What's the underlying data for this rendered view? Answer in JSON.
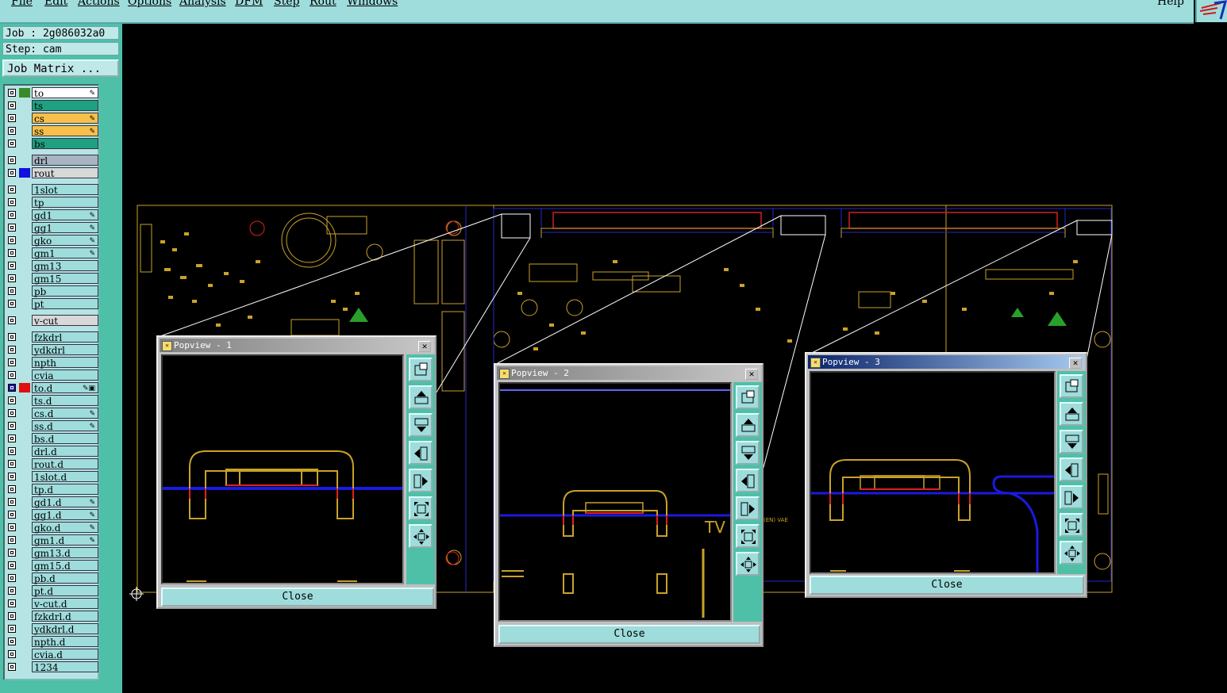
{
  "menu": [
    "File",
    "Edit",
    "Actions",
    "Options",
    "Analysis",
    "DFM",
    "Step",
    "Rout",
    "Windows"
  ],
  "help": "Help",
  "job_label": "Job : 2g086032a0",
  "step_label": "Step: cam",
  "job_matrix_label": "Job Matrix ...",
  "layers": [
    {
      "name": "to",
      "bg": "#ffffff",
      "swatch": "#3a8a2a",
      "flag": "✎"
    },
    {
      "name": "ts",
      "bg": "#1fa080",
      "swatch": "",
      "flag": ""
    },
    {
      "name": "cs",
      "bg": "#f6c04a",
      "swatch": "",
      "flag": "✎"
    },
    {
      "name": "ss",
      "bg": "#f6c04a",
      "swatch": "",
      "flag": "✎"
    },
    {
      "name": "bs",
      "bg": "#1fa080",
      "swatch": "",
      "flag": ""
    },
    {
      "name": "drl",
      "bg": "#a8b4c0",
      "swatch": "",
      "flag": ""
    },
    {
      "name": "rout",
      "bg": "#d8d8d8",
      "swatch": "#1010e0",
      "flag": ""
    },
    {
      "name": "1slot",
      "bg": "#9fdcdc",
      "swatch": "",
      "flag": ""
    },
    {
      "name": "tp",
      "bg": "#9fdcdc",
      "swatch": "",
      "flag": ""
    },
    {
      "name": "gd1",
      "bg": "#9fdcdc",
      "swatch": "",
      "flag": "✎"
    },
    {
      "name": "gg1",
      "bg": "#9fdcdc",
      "swatch": "",
      "flag": "✎"
    },
    {
      "name": "gko",
      "bg": "#9fdcdc",
      "swatch": "",
      "flag": "✎"
    },
    {
      "name": "gm1",
      "bg": "#9fdcdc",
      "swatch": "",
      "flag": "✎"
    },
    {
      "name": "gm13",
      "bg": "#9fdcdc",
      "swatch": "",
      "flag": ""
    },
    {
      "name": "gm15",
      "bg": "#9fdcdc",
      "swatch": "",
      "flag": ""
    },
    {
      "name": "pb",
      "bg": "#9fdcdc",
      "swatch": "",
      "flag": ""
    },
    {
      "name": "pt",
      "bg": "#9fdcdc",
      "swatch": "",
      "flag": ""
    },
    {
      "name": "v-cut",
      "bg": "#d8d8d8",
      "swatch": "",
      "flag": ""
    },
    {
      "name": "fzkdrl",
      "bg": "#9fdcdc",
      "swatch": "",
      "flag": ""
    },
    {
      "name": "ydkdrl",
      "bg": "#9fdcdc",
      "swatch": "",
      "flag": ""
    },
    {
      "name": "npth",
      "bg": "#9fdcdc",
      "swatch": "",
      "flag": ""
    },
    {
      "name": "cvia",
      "bg": "#9fdcdc",
      "swatch": "",
      "flag": ""
    },
    {
      "name": "to.d",
      "bg": "#9fdcdc",
      "swatch": "#e01010",
      "flag": "✎▣",
      "active": true
    },
    {
      "name": "ts.d",
      "bg": "#9fdcdc",
      "swatch": "",
      "flag": ""
    },
    {
      "name": "cs.d",
      "bg": "#9fdcdc",
      "swatch": "",
      "flag": "✎"
    },
    {
      "name": "ss.d",
      "bg": "#9fdcdc",
      "swatch": "",
      "flag": "✎"
    },
    {
      "name": "bs.d",
      "bg": "#9fdcdc",
      "swatch": "",
      "flag": ""
    },
    {
      "name": "drl.d",
      "bg": "#9fdcdc",
      "swatch": "",
      "flag": ""
    },
    {
      "name": "rout.d",
      "bg": "#9fdcdc",
      "swatch": "",
      "flag": ""
    },
    {
      "name": "1slot.d",
      "bg": "#9fdcdc",
      "swatch": "",
      "flag": ""
    },
    {
      "name": "tp.d",
      "bg": "#9fdcdc",
      "swatch": "",
      "flag": ""
    },
    {
      "name": "gd1.d",
      "bg": "#9fdcdc",
      "swatch": "",
      "flag": "✎"
    },
    {
      "name": "gg1.d",
      "bg": "#9fdcdc",
      "swatch": "",
      "flag": "✎"
    },
    {
      "name": "gko.d",
      "bg": "#9fdcdc",
      "swatch": "",
      "flag": "✎"
    },
    {
      "name": "gm1.d",
      "bg": "#9fdcdc",
      "swatch": "",
      "flag": "✎"
    },
    {
      "name": "gm13.d",
      "bg": "#9fdcdc",
      "swatch": "",
      "flag": ""
    },
    {
      "name": "gm15.d",
      "bg": "#9fdcdc",
      "swatch": "",
      "flag": ""
    },
    {
      "name": "pb.d",
      "bg": "#9fdcdc",
      "swatch": "",
      "flag": ""
    },
    {
      "name": "pt.d",
      "bg": "#9fdcdc",
      "swatch": "",
      "flag": ""
    },
    {
      "name": "v-cut.d",
      "bg": "#9fdcdc",
      "swatch": "",
      "flag": ""
    },
    {
      "name": "fzkdrl.d",
      "bg": "#9fdcdc",
      "swatch": "",
      "flag": ""
    },
    {
      "name": "ydkdrl.d",
      "bg": "#9fdcdc",
      "swatch": "",
      "flag": ""
    },
    {
      "name": "npth.d",
      "bg": "#9fdcdc",
      "swatch": "",
      "flag": ""
    },
    {
      "name": "cvia.d",
      "bg": "#9fdcdc",
      "swatch": "",
      "flag": ""
    },
    {
      "name": "1234",
      "bg": "#9fdcdc",
      "swatch": "",
      "flag": ""
    }
  ],
  "popups": [
    {
      "title": "Popview - 1",
      "close": "Close",
      "active": false
    },
    {
      "title": "Popview - 2",
      "close": "Close",
      "active": false
    },
    {
      "title": "Popview - 3",
      "close": "Close",
      "active": true
    }
  ],
  "tool_icons": [
    "zoom-window-icon",
    "pan-up-icon",
    "pan-down-icon",
    "pan-left-icon",
    "pan-right-icon",
    "zoom-in-icon",
    "zoom-out-icon"
  ],
  "board_text": {
    "tv": "TV",
    "en": "(EN) VAE"
  }
}
